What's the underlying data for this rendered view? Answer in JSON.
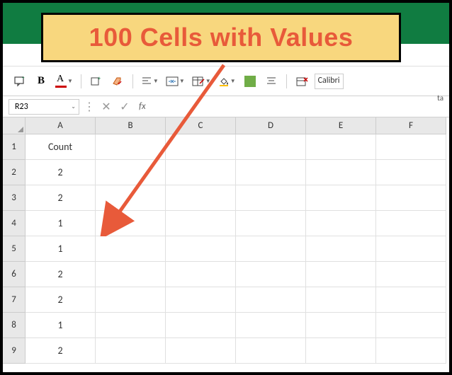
{
  "banner": {
    "text": "100 Cells with Values"
  },
  "ribbon": {
    "partial_text": "ta"
  },
  "toolbar": {
    "font_name": "Calibri"
  },
  "namebox": {
    "ref": "R23"
  },
  "formula_bar": {
    "fx": "fx",
    "value": ""
  },
  "columns": [
    "A",
    "B",
    "C",
    "D",
    "E",
    "F"
  ],
  "rows": [
    {
      "n": "1",
      "a": "Count"
    },
    {
      "n": "2",
      "a": "2"
    },
    {
      "n": "3",
      "a": "2"
    },
    {
      "n": "4",
      "a": "1"
    },
    {
      "n": "5",
      "a": "1"
    },
    {
      "n": "6",
      "a": "2"
    },
    {
      "n": "7",
      "a": "2"
    },
    {
      "n": "8",
      "a": "1"
    },
    {
      "n": "9",
      "a": "2"
    }
  ]
}
